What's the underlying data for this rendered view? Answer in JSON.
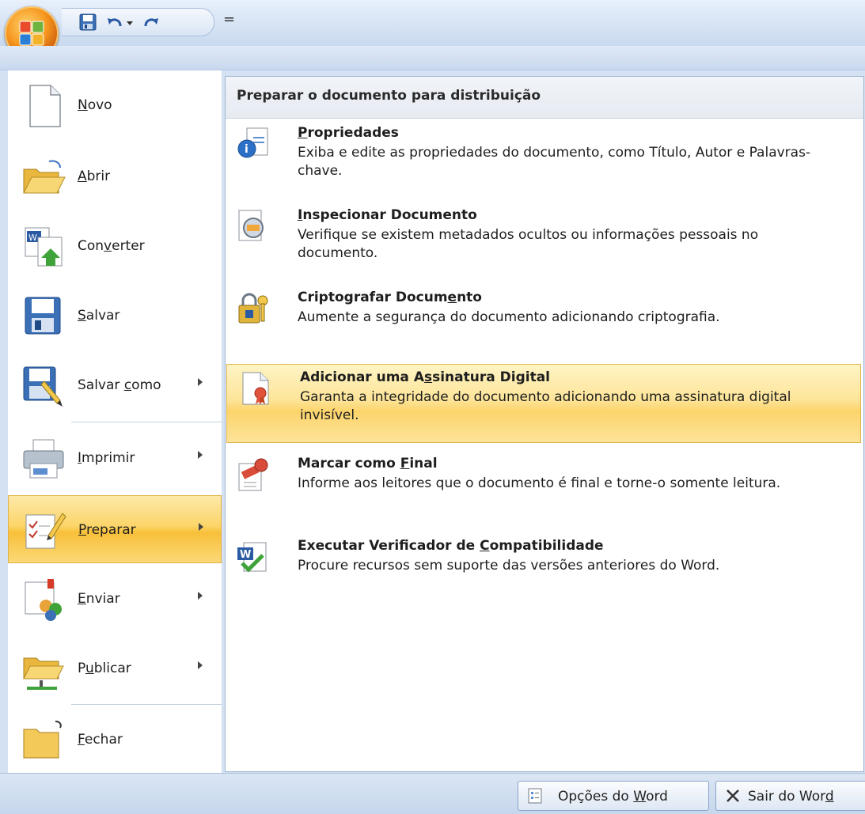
{
  "app": {
    "quick_access_dropdown": "="
  },
  "left_menu": {
    "items": [
      {
        "label_pre": "",
        "label_ul": "N",
        "label_post": "ovo"
      },
      {
        "label_pre": "",
        "label_ul": "A",
        "label_post": "brir"
      },
      {
        "label_pre": "Con",
        "label_ul": "v",
        "label_post": "erter"
      },
      {
        "label_pre": "",
        "label_ul": "S",
        "label_post": "alvar"
      },
      {
        "label_pre": "Salvar ",
        "label_ul": "c",
        "label_post": "omo"
      },
      {
        "label_pre": "",
        "label_ul": "I",
        "label_post": "mprimir"
      },
      {
        "label_pre": "",
        "label_ul": "P",
        "label_post": "reparar"
      },
      {
        "label_pre": "",
        "label_ul": "E",
        "label_post": "nviar"
      },
      {
        "label_pre": "P",
        "label_ul": "u",
        "label_post": "blicar"
      },
      {
        "label_pre": "",
        "label_ul": "F",
        "label_post": "echar"
      }
    ]
  },
  "submenu": {
    "header": "Preparar o documento para distribuição",
    "items": [
      {
        "title_pre": "",
        "title_ul": "P",
        "title_post": "ropriedades",
        "desc": "Exiba e edite as propriedades do documento, como Título, Autor e Palavras-chave."
      },
      {
        "title_pre": "",
        "title_ul": "I",
        "title_post": "nspecionar Documento",
        "desc": "Verifique se existem metadados ocultos ou informações pessoais no documento."
      },
      {
        "title_pre": "Criptografar Docum",
        "title_ul": "e",
        "title_post": "nto",
        "desc": "Aumente a segurança do documento adicionando criptografia."
      },
      {
        "title_pre": "Adicionar uma A",
        "title_ul": "s",
        "title_post": "sinatura Digital",
        "desc": "Garanta a integridade do documento adicionando uma assinatura digital invisível."
      },
      {
        "title_pre": "Marcar como ",
        "title_ul": "F",
        "title_post": "inal",
        "desc": "Informe aos leitores que o documento é final e torne-o somente leitura."
      },
      {
        "title_pre": "Executar Verificador de ",
        "title_ul": "C",
        "title_post": "ompatibilidade",
        "desc": "Procure recursos sem suporte das versões anteriores do Word."
      }
    ]
  },
  "footer": {
    "options_pre": "Opções do ",
    "options_ul": "W",
    "options_post": "ord",
    "exit_pre": "Sair do Wor",
    "exit_ul": "d",
    "exit_post": ""
  }
}
